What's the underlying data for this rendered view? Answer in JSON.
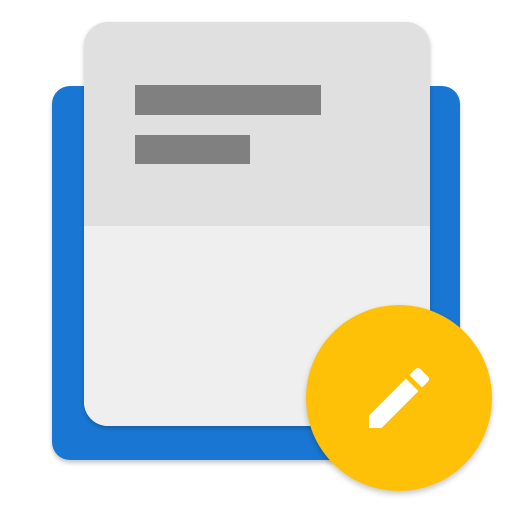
{
  "icon": {
    "type": "notes-app-icon",
    "colors": {
      "folder": "#1976d2",
      "card_header": "#e0e0e0",
      "card_body": "#efefef",
      "text_placeholder": "#808080",
      "badge": "#ffc107",
      "pencil": "#ffffff"
    },
    "elements": {
      "background_shape": "blue-folder",
      "card": "note-card",
      "header_lines": [
        "text-line-1",
        "text-line-2"
      ],
      "badge_icon": "pencil-icon"
    }
  }
}
